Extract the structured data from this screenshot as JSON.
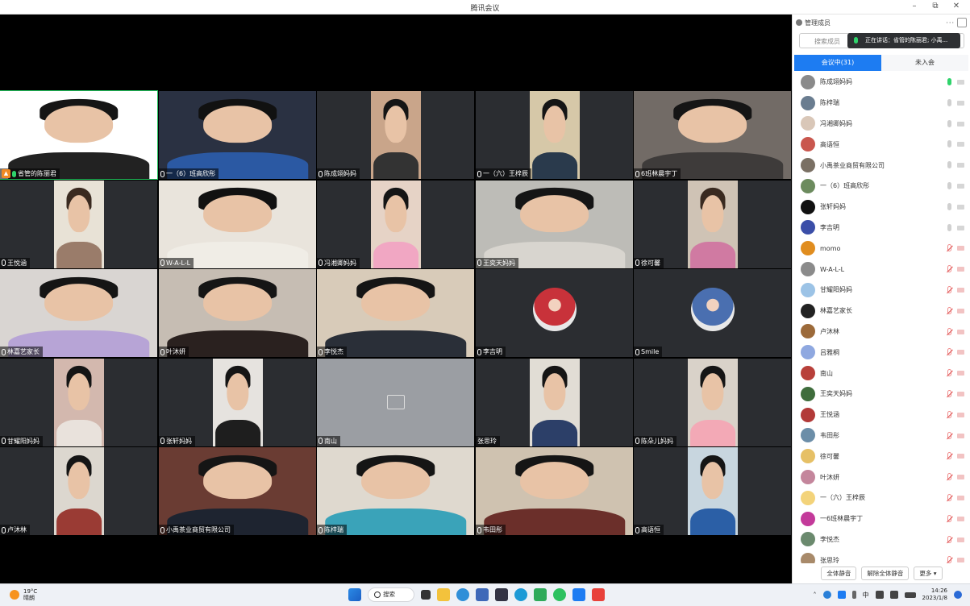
{
  "window": {
    "title": "腾讯会议",
    "minimize": "–",
    "restore": "⧉",
    "close": "✕"
  },
  "tiles": [
    {
      "name": "省管的陈丽君",
      "host": true,
      "speaking": true,
      "bg": "#b9b9b6",
      "feed": "#ffffff",
      "shirt": "#222222",
      "hair": "#151515",
      "feedW": 1.0
    },
    {
      "name": "一（6）班高欣彤",
      "bg": "#2b2d31",
      "feed": "#2a3142",
      "shirt": "#2b59a3",
      "hair": "#111111",
      "feedW": 1.0
    },
    {
      "name": "陈成翊妈妈",
      "bg": "#2b2d31",
      "feed": "#c9a58a",
      "shirt": "#333333",
      "hair": "#151515",
      "feedW": 0.32
    },
    {
      "name": "一（六）王梓辰",
      "bg": "#2b2d31",
      "feed": "#d6c8a8",
      "shirt": "#2a3a4c",
      "hair": "#151515",
      "feedW": 0.32
    },
    {
      "name": "6班林晨宇丁",
      "bg": "#2b2d31",
      "feed": "#726b66",
      "shirt": "#3e3b3a",
      "hair": "#151515",
      "feedW": 1.0
    },
    {
      "name": "王悦涵",
      "bg": "#2b2d31",
      "feed": "#e8e2d6",
      "shirt": "#9a7c6a",
      "hair": "#3a2a20",
      "feedW": 0.32
    },
    {
      "name": "W-A-L-L",
      "bg": "#2b2d31",
      "feed": "#e9e4dc",
      "shirt": "#f0ede6",
      "hair": "#111111",
      "feedW": 1.0
    },
    {
      "name": "冯湘卿妈妈",
      "bg": "#2b2d31",
      "feed": "#e6d3c6",
      "shirt": "#f1a7c3",
      "hair": "#151515",
      "feedW": 0.32
    },
    {
      "name": "王奕天妈妈",
      "bg": "#2b2d31",
      "feed": "#bdbcb7",
      "shirt": "#d8d5cf",
      "hair": "#151515",
      "feedW": 1.0
    },
    {
      "name": "徐可馨",
      "bg": "#2b2d31",
      "feed": "#cfc3b5",
      "shirt": "#d07aa2",
      "hair": "#3a2a20",
      "feedW": 0.32
    },
    {
      "name": "林嘉艺家长",
      "bg": "#2b2d31",
      "feed": "#d9d5d2",
      "shirt": "#b7a4d6",
      "hair": "#151515",
      "feedW": 1.0
    },
    {
      "name": "叶沐妍",
      "bg": "#2b2d31",
      "feed": "#c6bdb3",
      "shirt": "#2a211f",
      "hair": "#151515",
      "feedW": 1.0
    },
    {
      "name": "李悦杰",
      "bg": "#2b2d31",
      "feed": "#d8cbb9",
      "shirt": "#2a2f38",
      "hair": "#151515",
      "feedW": 1.0
    },
    {
      "name": "李吉明",
      "avatar": true,
      "avatarColor": "#c8323a",
      "bg": "#2b2d31"
    },
    {
      "name": "Smile",
      "avatar": true,
      "avatarColor": "#4a6fb0",
      "bg": "#2b2d31"
    },
    {
      "name": "甘耀阳妈妈",
      "bg": "#2b2d31",
      "feed": "#d3b8ae",
      "shirt": "#e9e2dc",
      "hair": "#151515",
      "feedW": 0.32
    },
    {
      "name": "张轩妈妈",
      "bg": "#2b2d31",
      "feed": "#e6e3df",
      "shirt": "#1e1e1e",
      "hair": "#151515",
      "feedW": 0.32
    },
    {
      "name": "南山",
      "locked": true,
      "bg": "#9b9ea3"
    },
    {
      "name": "张思玲",
      "nomic": true,
      "bg": "#2b2d31",
      "feed": "#e1ddd5",
      "shirt": "#2c3f68",
      "hair": "#151515",
      "feedW": 0.32
    },
    {
      "name": "陈朵儿妈妈",
      "bg": "#2b2d31",
      "feed": "#d9d2c9",
      "shirt": "#f3a9b6",
      "hair": "#151515",
      "feedW": 0.32
    },
    {
      "name": "卢沐林",
      "bg": "#2b2d31",
      "feed": "#dcd7cf",
      "shirt": "#9a3b34",
      "hair": "#151515",
      "feedW": 0.32
    },
    {
      "name": "小禹茶业商贸有限公司",
      "bg": "#2b2d31",
      "feed": "#6a3c33",
      "shirt": "#1e2430",
      "hair": "#151515",
      "feedW": 1.0
    },
    {
      "name": "陈梓瑞",
      "bg": "#2b2d31",
      "feed": "#dfd9cf",
      "shirt": "#3aa3b9",
      "hair": "#151515",
      "feedW": 1.0
    },
    {
      "name": "韦田彤",
      "bg": "#2b2d31",
      "feed": "#cfc2b0",
      "shirt": "#6b2f2a",
      "hair": "#151515",
      "feedW": 1.0
    },
    {
      "name": "高语恒",
      "bg": "#2b2d31",
      "feed": "#c8d6df",
      "shirt": "#2b5fa6",
      "hair": "#151515",
      "feedW": 0.32
    }
  ],
  "panel": {
    "title": "管理成员",
    "dots": "···",
    "search_placeholder": "搜索成员",
    "toast": "正在讲话：省管的陈丽君; 小禹...",
    "tab_in": "会议中(31)",
    "tab_wait": "未入会",
    "members": [
      {
        "name": "陈成翊妈妈",
        "color": "#8a8a8a",
        "mic": "green",
        "cam": "off"
      },
      {
        "name": "陈梓瑞",
        "color": "#6a7d90",
        "mic": "on",
        "cam": "off"
      },
      {
        "name": "冯湘卿妈妈",
        "color": "#d9c7b8",
        "mic": "on",
        "cam": "off"
      },
      {
        "name": "高语恒",
        "color": "#c9574e",
        "mic": "on",
        "cam": "off"
      },
      {
        "name": "小禹茶业商贸有限公司",
        "color": "#7a7064",
        "mic": "on",
        "cam": "off"
      },
      {
        "name": "一（6）班高欣彤",
        "color": "#6c8b5e",
        "mic": "on",
        "cam": "off"
      },
      {
        "name": "张轩妈妈",
        "color": "#111111",
        "mic": "on",
        "cam": "off"
      },
      {
        "name": "李吉明",
        "color": "#3b4ea8",
        "mic": "on",
        "cam": "off"
      },
      {
        "name": "momo",
        "color": "#e08d1f",
        "mic": "muted",
        "cam": "off"
      },
      {
        "name": "W-A-L-L",
        "color": "#8b8b8b",
        "mic": "muted",
        "cam": "off"
      },
      {
        "name": "甘耀阳妈妈",
        "color": "#9cc3e6",
        "mic": "muted",
        "cam": "off"
      },
      {
        "name": "林嘉艺家长",
        "color": "#222222",
        "mic": "muted",
        "cam": "off"
      },
      {
        "name": "卢沐林",
        "color": "#9c6a3a",
        "mic": "muted",
        "cam": "off"
      },
      {
        "name": "吕雅桐",
        "color": "#8fa8e0",
        "mic": "muted",
        "cam": "off"
      },
      {
        "name": "南山",
        "color": "#b8403a",
        "mic": "muted",
        "cam": "off"
      },
      {
        "name": "王奕天妈妈",
        "color": "#3f6d3c",
        "mic": "muted",
        "cam": "off"
      },
      {
        "name": "王悦涵",
        "color": "#b23a38",
        "mic": "muted",
        "cam": "off"
      },
      {
        "name": "韦田彤",
        "color": "#6c8ea8",
        "mic": "muted",
        "cam": "off"
      },
      {
        "name": "徐可馨",
        "color": "#e6c066",
        "mic": "muted",
        "cam": "off"
      },
      {
        "name": "叶沐妍",
        "color": "#c4869c",
        "mic": "muted",
        "cam": "off"
      },
      {
        "name": "一（六）王梓辰",
        "color": "#f3d37a",
        "mic": "muted",
        "cam": "off"
      },
      {
        "name": "一6班林晨宇丁",
        "color": "#c33a9a",
        "mic": "muted",
        "cam": "off"
      },
      {
        "name": "李悦杰",
        "color": "#6b8a6e",
        "mic": "muted",
        "cam": "off"
      },
      {
        "name": "张思玲",
        "color": "#a88a6a",
        "mic": "muted",
        "cam": "off"
      }
    ],
    "btn_mute_all": "全体静音",
    "btn_unmute_all": "解除全体静音",
    "btn_more": "更多 ▾"
  },
  "taskbar": {
    "temp": "19°C",
    "weather": "晴朗",
    "search": "搜索",
    "ime": "中",
    "time": "14:26",
    "date": "2023/1/8"
  }
}
